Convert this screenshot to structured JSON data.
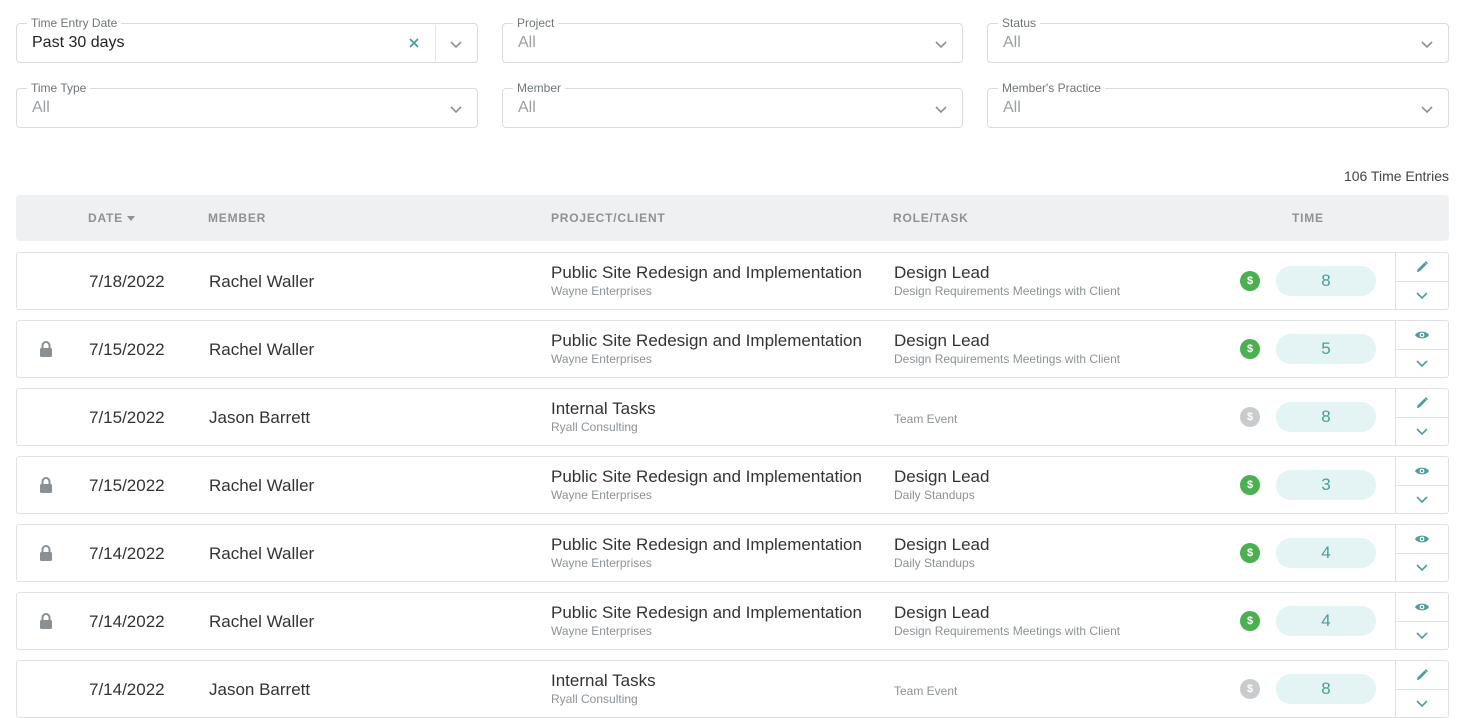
{
  "filters": {
    "time_entry_date": {
      "label": "Time Entry Date",
      "value": "Past 30 days"
    },
    "project": {
      "label": "Project",
      "value": "All"
    },
    "status": {
      "label": "Status",
      "value": "All"
    },
    "time_type": {
      "label": "Time Type",
      "value": "All"
    },
    "member": {
      "label": "Member",
      "value": "All"
    },
    "members_practice": {
      "label": "Member's Practice",
      "value": "All"
    }
  },
  "entries_count": "106 Time Entries",
  "columns": {
    "date": "DATE",
    "member": "MEMBER",
    "project": "PROJECT/CLIENT",
    "role": "ROLE/TASK",
    "time": "TIME"
  },
  "rows": [
    {
      "locked": false,
      "date": "7/18/2022",
      "member": "Rachel Waller",
      "project": "Public Site Redesign and Implementation",
      "client": "Wayne Enterprises",
      "role": "Design Lead",
      "task": "Design Requirements Meetings with Client",
      "billable": true,
      "hours": "8",
      "action": "edit"
    },
    {
      "locked": true,
      "date": "7/15/2022",
      "member": "Rachel Waller",
      "project": "Public Site Redesign and Implementation",
      "client": "Wayne Enterprises",
      "role": "Design Lead",
      "task": "Design Requirements Meetings with Client",
      "billable": true,
      "hours": "5",
      "action": "view"
    },
    {
      "locked": false,
      "date": "7/15/2022",
      "member": "Jason Barrett",
      "project": "Internal Tasks",
      "client": "Ryall Consulting",
      "role": "",
      "task": "Team Event",
      "billable": false,
      "hours": "8",
      "action": "edit"
    },
    {
      "locked": true,
      "date": "7/15/2022",
      "member": "Rachel Waller",
      "project": "Public Site Redesign and Implementation",
      "client": "Wayne Enterprises",
      "role": "Design Lead",
      "task": "Daily Standups",
      "billable": true,
      "hours": "3",
      "action": "view"
    },
    {
      "locked": true,
      "date": "7/14/2022",
      "member": "Rachel Waller",
      "project": "Public Site Redesign and Implementation",
      "client": "Wayne Enterprises",
      "role": "Design Lead",
      "task": "Daily Standups",
      "billable": true,
      "hours": "4",
      "action": "view"
    },
    {
      "locked": true,
      "date": "7/14/2022",
      "member": "Rachel Waller",
      "project": "Public Site Redesign and Implementation",
      "client": "Wayne Enterprises",
      "role": "Design Lead",
      "task": "Design Requirements Meetings with Client",
      "billable": true,
      "hours": "4",
      "action": "view"
    },
    {
      "locked": false,
      "date": "7/14/2022",
      "member": "Jason Barrett",
      "project": "Internal Tasks",
      "client": "Ryall Consulting",
      "role": "",
      "task": "Team Event",
      "billable": false,
      "hours": "8",
      "action": "edit"
    }
  ],
  "billable_symbol": "$",
  "icons": {
    "lock": "lock-icon",
    "edit": "pencil-icon",
    "view": "eye-icon",
    "expand": "chevron-down-icon",
    "clear": "close-icon",
    "dropdown": "chevron-down-icon",
    "sort": "sort-desc-icon"
  },
  "colors": {
    "billable": "#4caf50",
    "non_billable": "#c9cccf",
    "accent": "#4b9e9a",
    "time_pill": "#e4f3f3",
    "header_bg": "#eef0f1"
  }
}
